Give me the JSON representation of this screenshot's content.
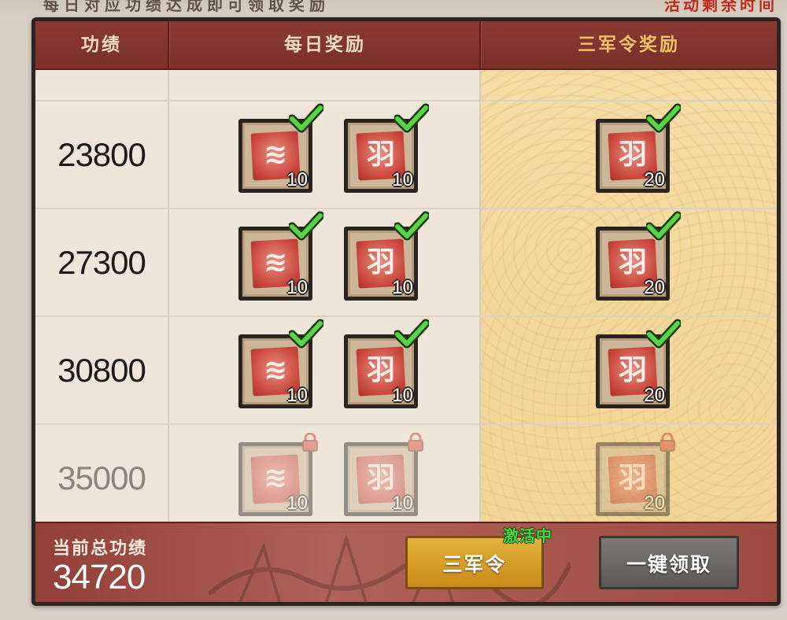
{
  "top_banner": {
    "left_text": "每日对应功绩达成即可领取奖励",
    "right_text": "活动剩余时间"
  },
  "header": {
    "col_score": "功绩",
    "col_daily": "每日奖励",
    "col_sanjun": "三军令奖励"
  },
  "icons": {
    "item_a": "coin-stack-icon",
    "item_b": "boot-token-icon",
    "claimed": "green-check-icon",
    "locked": "padlock-icon"
  },
  "rows": [
    {
      "score": "23800",
      "state": "claimed",
      "daily": [
        {
          "icon": "coin-stack-icon",
          "qty": "10"
        },
        {
          "icon": "boot-token-icon",
          "qty": "10"
        }
      ],
      "sanjun": {
        "icon": "boot-token-icon",
        "qty": "20"
      }
    },
    {
      "score": "27300",
      "state": "claimed",
      "daily": [
        {
          "icon": "coin-stack-icon",
          "qty": "10"
        },
        {
          "icon": "boot-token-icon",
          "qty": "10"
        }
      ],
      "sanjun": {
        "icon": "boot-token-icon",
        "qty": "20"
      }
    },
    {
      "score": "30800",
      "state": "claimed",
      "daily": [
        {
          "icon": "coin-stack-icon",
          "qty": "10"
        },
        {
          "icon": "boot-token-icon",
          "qty": "10"
        }
      ],
      "sanjun": {
        "icon": "boot-token-icon",
        "qty": "20"
      }
    },
    {
      "score": "35000",
      "state": "locked",
      "daily": [
        {
          "icon": "coin-stack-icon",
          "qty": "10"
        },
        {
          "icon": "boot-token-icon",
          "qty": "10"
        }
      ],
      "sanjun": {
        "icon": "boot-token-icon",
        "qty": "20"
      }
    }
  ],
  "footer": {
    "total_label": "当前总功绩",
    "total_value": "34720",
    "sanjun_button": "三军令",
    "sanjun_status": "激活中",
    "claim_all_button": "一键领取"
  },
  "colors": {
    "header_red": "#7b2f29",
    "gold_header_text": "#f0c168",
    "active_green": "#46d93a",
    "gold_button": "#d9a22d",
    "gray_button": "#6a6764"
  }
}
